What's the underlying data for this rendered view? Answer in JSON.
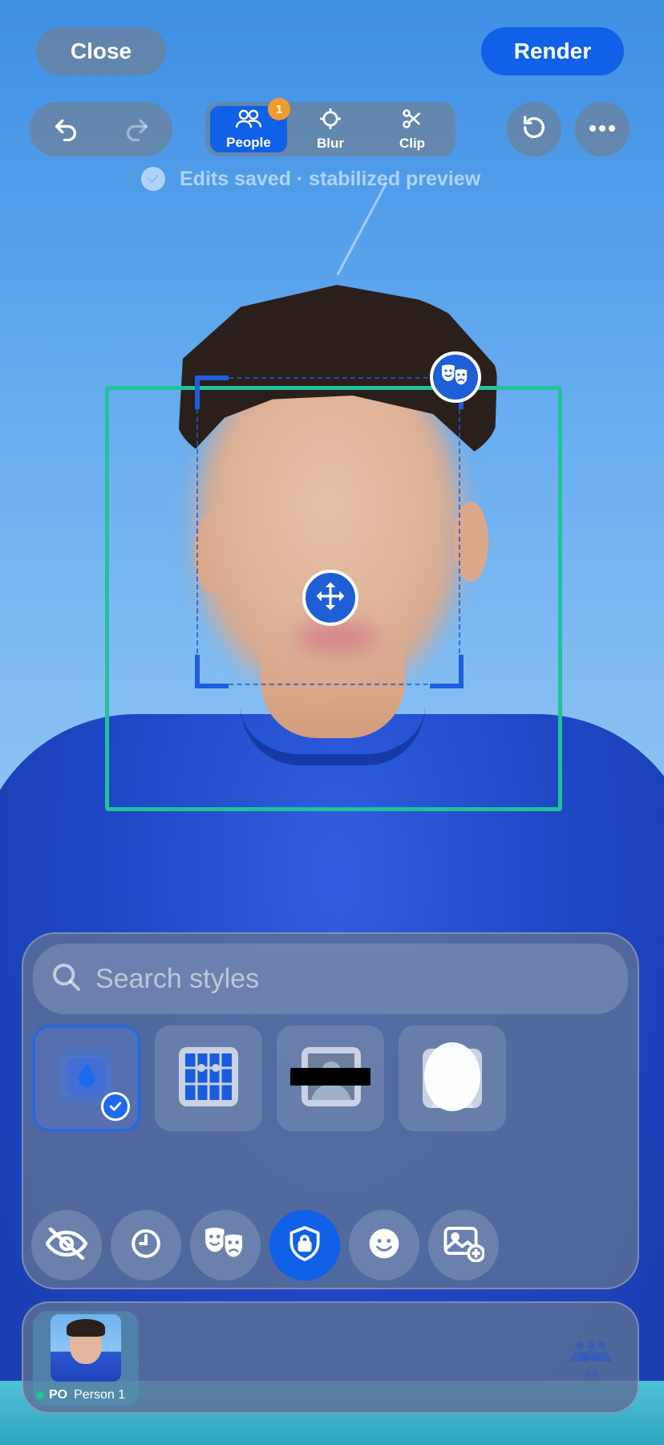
{
  "header": {
    "close_label": "Close",
    "render_label": "Render"
  },
  "toolbar": {
    "tools": [
      {
        "label": "People",
        "icon": "people-icon",
        "active": true,
        "badge": "1"
      },
      {
        "label": "Blur",
        "icon": "crosshair-icon",
        "active": false
      },
      {
        "label": "Clip",
        "icon": "scissors-icon",
        "active": false
      }
    ],
    "status_text": "Edits saved · stabilized preview"
  },
  "search": {
    "placeholder": "Search styles"
  },
  "styles": [
    {
      "icon": "blur-drop-icon",
      "selected": true
    },
    {
      "icon": "pixelate-icon",
      "selected": false
    },
    {
      "icon": "black-bar-icon",
      "selected": false
    },
    {
      "icon": "silhouette-icon",
      "selected": false
    }
  ],
  "modes": [
    {
      "icon": "eye-off-icon",
      "active": false
    },
    {
      "icon": "clock-icon",
      "active": false
    },
    {
      "icon": "masks-icon",
      "active": false
    },
    {
      "icon": "shield-lock-icon",
      "active": true
    },
    {
      "icon": "smiley-icon",
      "active": false
    },
    {
      "icon": "add-image-icon",
      "active": false
    }
  ],
  "people": [
    {
      "id": "PO",
      "name": "Person 1"
    }
  ],
  "all_label": "All",
  "colors": {
    "accent": "#1160e8",
    "track_box": "#20c29a",
    "badge": "#f39a2d"
  }
}
